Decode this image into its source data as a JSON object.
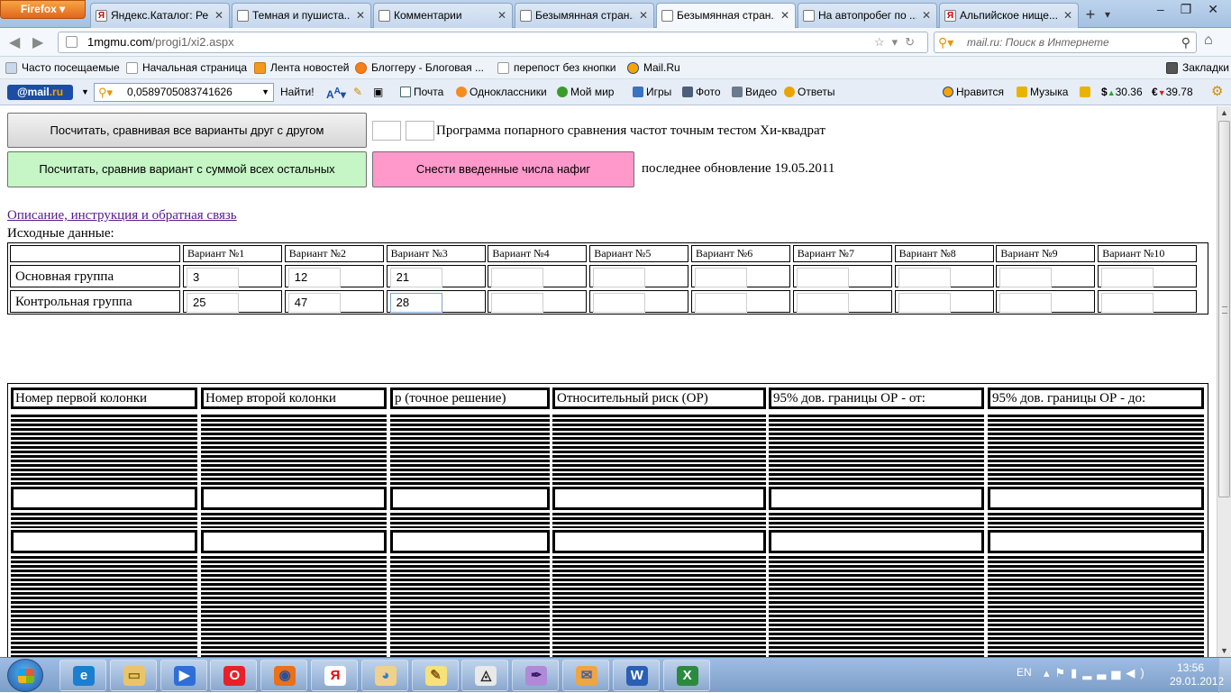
{
  "browser": {
    "app_button": "Firefox",
    "tabs": [
      {
        "label": "Яндекс.Каталог: Ре...",
        "icon": "yandex-icon"
      },
      {
        "label": "Темная и пушиста...",
        "icon": "person-icon"
      },
      {
        "label": "Комментарии",
        "icon": "clip-icon"
      },
      {
        "label": "Безымянная стран...",
        "icon": "blank-page-icon"
      },
      {
        "label": "Безымянная стран...",
        "icon": "blank-page-icon",
        "active": true
      },
      {
        "label": "На автопробег по ...",
        "icon": "blank-page-icon"
      },
      {
        "label": "Альпийское нище...",
        "icon": "yandex-icon"
      }
    ],
    "new_tab": "+",
    "url_host": "1mgmu.com",
    "url_path": "/progi1/xi2.aspx",
    "search_placeholder": "mail.ru: Поиск в Интернете"
  },
  "bookmarks": [
    "Часто посещаемые",
    "Начальная страница",
    "Лента новостей",
    "Блоггеру - Блоговая ...",
    "перепост без кнопки",
    "Mail.Ru"
  ],
  "bookmarks_menu": "Закладки",
  "mailbar": {
    "logo_at": "@mail",
    "logo_ru": ".ru",
    "search_value": "0,0589705083741626",
    "find": "Найти!",
    "items": [
      "Почта",
      "Одноклассники",
      "Мой мир",
      "Игры",
      "Фото",
      "Видео",
      "Ответы",
      "Нравится",
      "Музыка"
    ],
    "usd": "30.36",
    "eur": "39.78"
  },
  "page": {
    "btn_compare_all": "Посчитать, сравнивая все варианты друг с другом",
    "btn_compare_sum": "Посчитать, сравнив вариант с суммой всех остальных",
    "btn_clear": "Снести введенные числа нафиг",
    "program_title": "Программа попарного сравнения частот точным тестом Хи-квадрат",
    "last_update": "последнее обновление 19.05.2011",
    "description_link": "Описание, инструкция и обратная связь",
    "source_label": "Исходные данные:",
    "variants": [
      "Вариант №1",
      "Вариант №2",
      "Вариант №3",
      "Вариант №4",
      "Вариант №5",
      "Вариант №6",
      "Вариант №7",
      "Вариант №8",
      "Вариант №9",
      "Вариант №10"
    ],
    "rows": [
      {
        "label": "Основная группа",
        "values": [
          "3",
          "12",
          "21",
          "",
          "",
          "",
          "",
          "",
          "",
          ""
        ]
      },
      {
        "label": "Контрольная группа",
        "values": [
          "25",
          "47",
          "28",
          "",
          "",
          "",
          "",
          "",
          "",
          ""
        ]
      }
    ],
    "result_headers": [
      "Номер первой колонки",
      "Номер второй колонки",
      "p (точное решение)",
      "Относительный риск (ОР)",
      "95% дов. границы ОР - от:",
      "95% дов. границы ОР - до:"
    ]
  },
  "taskbar": {
    "apps": [
      "explorer-icon",
      "ie-icon",
      "folder-icon",
      "media-icon",
      "opera-icon",
      "firefox-icon",
      "yandex-icon",
      "paint-icon",
      "editor-icon",
      "eye-icon",
      "pen-icon",
      "mail-icon",
      "word-icon",
      "excel-icon"
    ],
    "lang": "EN",
    "time": "13:56",
    "date": "29.01.2012"
  }
}
